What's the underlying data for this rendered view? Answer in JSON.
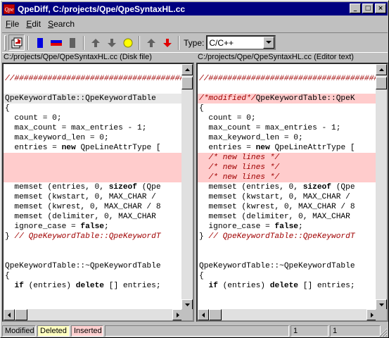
{
  "window": {
    "app_icon_text": "Qpe",
    "title": "QpeDiff, C:/projects/Qpe/QpeSyntaxHL.cc",
    "minimize": "_",
    "maximize": "□",
    "close": "×"
  },
  "menu": [
    {
      "label": "File",
      "accel": "F"
    },
    {
      "label": "Edit",
      "accel": "E"
    },
    {
      "label": "Search",
      "accel": "S"
    }
  ],
  "toolbar": {
    "type_label": "Type:",
    "type_value": "C/C++",
    "icons": [
      "open-file-icon",
      "diff-left-icon",
      "diff-both-icon",
      "diff-right-icon",
      "arrow-up-icon",
      "arrow-down-icon",
      "current-diff-icon",
      "prev-change-icon",
      "next-change-icon"
    ],
    "colors": {
      "blue": "#0000e0",
      "red": "#e00000",
      "gray": "#606060",
      "yellow": "#ffff00"
    }
  },
  "left": {
    "header": "C:/projects/Qpe/QpeSyntaxHL.cc (Disk file)",
    "lines": [
      {
        "t": ""
      },
      {
        "t": "",
        "c": "//####################################"
      },
      {
        "t": ""
      },
      {
        "t": "QpeKeywordTable::QpeKeywordTable",
        "cur": true
      },
      {
        "t": "{"
      },
      {
        "t": "  count = 0;"
      },
      {
        "t": "  max_count = max_entries - 1;"
      },
      {
        "t": "  max_keyword_len = 0;"
      },
      {
        "t": "  entries = ",
        "k": "new",
        "a": " QpeLineAttrType ["
      },
      {
        "t": "",
        "hl": true
      },
      {
        "t": "",
        "hl": true
      },
      {
        "t": "",
        "hl": true
      },
      {
        "t": "  memset (entries, 0, ",
        "k": "sizeof",
        "a": " (Qpe"
      },
      {
        "t": "  memset (kwstart, 0, MAX_CHAR /"
      },
      {
        "t": "  memset (kwrest, 0, MAX_CHAR / 8"
      },
      {
        "t": "  memset (delimiter, 0, MAX_CHAR"
      },
      {
        "t": "  ignore_case = ",
        "k": "false",
        "a": ";"
      },
      {
        "t": "} ",
        "c": "// QpeKeywordTable::QpeKeywordT"
      },
      {
        "t": ""
      },
      {
        "t": ""
      },
      {
        "t": "QpeKeywordTable::~QpeKeywordTable"
      },
      {
        "t": "{"
      },
      {
        "t": "  ",
        "k": "if",
        "a": " (entries) ",
        "k2": "delete",
        "a2": " [] entries;"
      }
    ]
  },
  "right": {
    "header": "C:/projects/Qpe/QpeSyntaxHL.cc (Editor text)",
    "lines": [
      {
        "t": ""
      },
      {
        "t": "",
        "c": "//####################################"
      },
      {
        "t": ""
      },
      {
        "t": "",
        "c": "/*modified*/",
        "a": "QpeKeywordTable::QpeK",
        "hl": true
      },
      {
        "t": "{"
      },
      {
        "t": "  count = 0;"
      },
      {
        "t": "  max_count = max_entries - 1;"
      },
      {
        "t": "  max_keyword_len = 0;"
      },
      {
        "t": "  entries = ",
        "k": "new",
        "a": " QpeLineAttrType ["
      },
      {
        "t": "  ",
        "c": "/* new lines */",
        "hl": true
      },
      {
        "t": "  ",
        "c": "/* new lines */",
        "hl": true
      },
      {
        "t": "  ",
        "c": "/* new lines */",
        "hl": true
      },
      {
        "t": "  memset (entries, 0, ",
        "k": "sizeof",
        "a": " (Qpe"
      },
      {
        "t": "  memset (kwstart, 0, MAX_CHAR /"
      },
      {
        "t": "  memset (kwrest, 0, MAX_CHAR / 8"
      },
      {
        "t": "  memset (delimiter, 0, MAX_CHAR"
      },
      {
        "t": "  ignore_case = ",
        "k": "false",
        "a": ";"
      },
      {
        "t": "} ",
        "c": "// QpeKeywordTable::QpeKeywordT"
      },
      {
        "t": ""
      },
      {
        "t": ""
      },
      {
        "t": "QpeKeywordTable::~QpeKeywordTable"
      },
      {
        "t": "{"
      },
      {
        "t": "  ",
        "k": "if",
        "a": " (entries) ",
        "k2": "delete",
        "a2": " [] entries;"
      }
    ]
  },
  "status": {
    "modified": "Modified",
    "deleted": "Deleted",
    "inserted": "Inserted",
    "left_line": "1",
    "right_line": "1",
    "colors": {
      "deleted_bg": "#ffffc0",
      "inserted_bg": "#ffd0d0"
    }
  }
}
